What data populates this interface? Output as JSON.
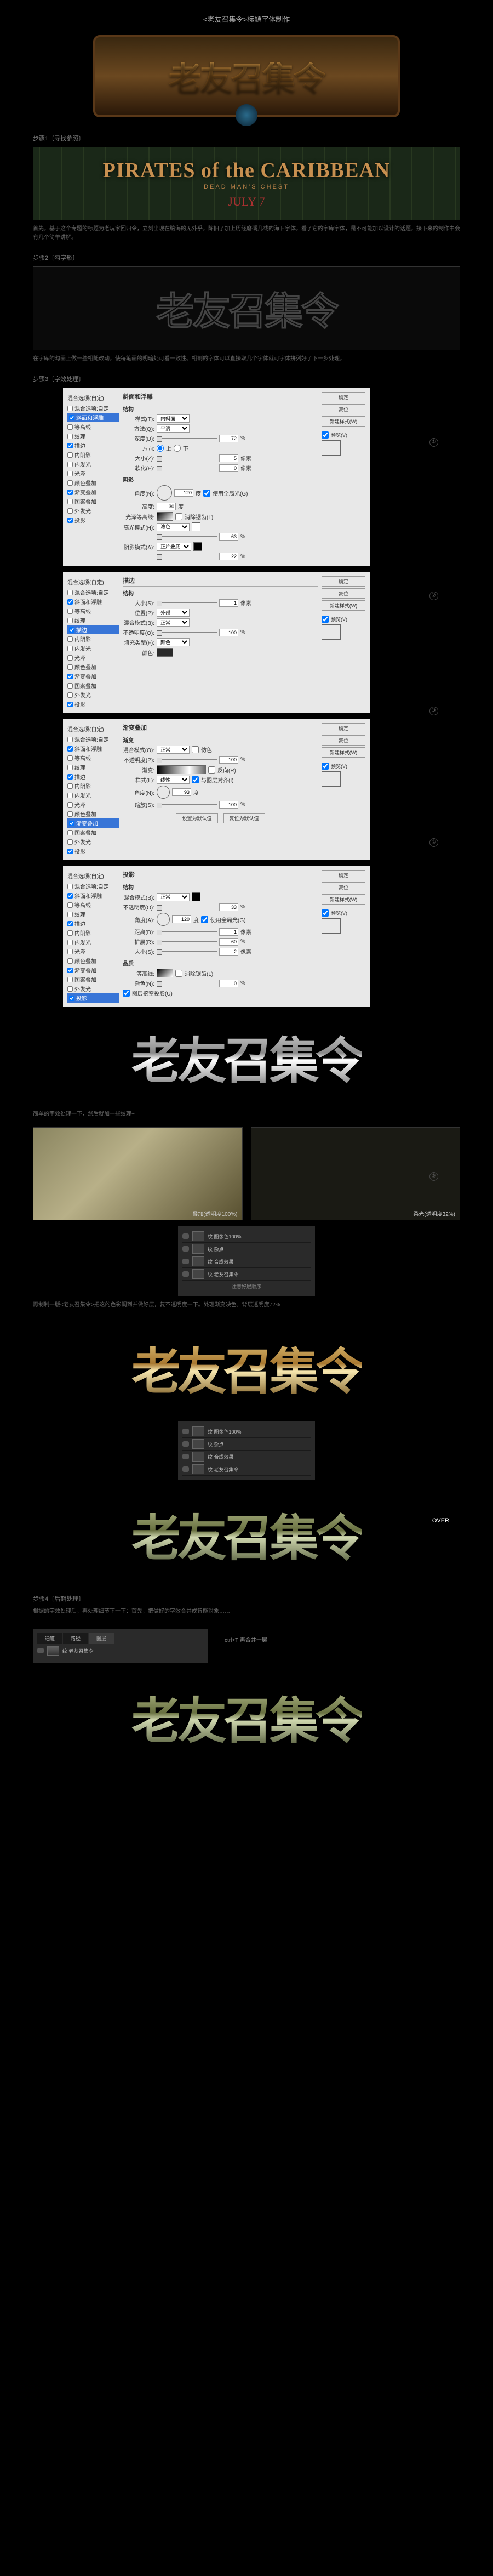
{
  "page_title": "<老友召集令>标题字体制作",
  "hero_text": "老友召集令",
  "steps": {
    "s1": {
      "label": "步骤1〔寻找参照〕",
      "caption": "首先，基于这个专题的标题为老玩家回归令，立刻出现在脑海的无外乎，陈旧了加上历经磨砺几载的海旧字体。看了它的字库字体，是不可能加以设计的话题，接下来的制作中会有几个简单讲解。"
    },
    "s2": {
      "label": "步骤2〔勾字形〕",
      "caption": "在字库的勾画上做一些相随改动，使每笔画的明暗处可看一致性。相割的字体可以直接取几个字体就可字体拼列好了下一步处理。"
    },
    "s3": {
      "label": "步骤3〔字效处理〕"
    },
    "s4": {
      "label": "步骤4〔后期处理〕",
      "caption": "根据的字效处理后，再处理细节下一下：首先，把做好的字效合并成智能对象……"
    }
  },
  "ref": {
    "title": "PIRATES of the CARIBBEAN",
    "sub": "DEAD MAN'S CHEST",
    "date": "JULY 7"
  },
  "markers": [
    "①",
    "②",
    "③",
    "④",
    "⑤"
  ],
  "ps": {
    "side_title": "混合选项(自定)",
    "checks": [
      "混合选项:自定",
      "斜面和浮雕",
      "等高线",
      "纹理",
      "描边",
      "内阴影",
      "内发光",
      "光泽",
      "颜色叠加",
      "渐变叠加",
      "图案叠加",
      "外发光",
      "投影"
    ],
    "btns": [
      "确定",
      "复位",
      "新建样式(W)"
    ],
    "preview_label": "预览(V)",
    "panel1": {
      "title": "斜面和浮雕",
      "sub": "结构",
      "style_label": "样式(T):",
      "style_val": "内斜面",
      "method_label": "方法(Q):",
      "method_val": "平滑",
      "depth_label": "深度(D):",
      "depth_val": "72",
      "depth_unit": "%",
      "dir_label": "方向:",
      "dir_up": "上",
      "dir_down": "下",
      "size_label": "大小(Z):",
      "size_val": "5",
      "size_unit": "像素",
      "soft_label": "软化(F):",
      "soft_val": "0",
      "soft_unit": "像素",
      "shade_title": "阴影",
      "angle_label": "角度(N):",
      "angle_val": "120",
      "angle_unit": "度",
      "global_label": "使用全局光(G)",
      "alt_label": "高度:",
      "alt_val": "30",
      "alt_unit": "度",
      "gloss_label": "光泽等高线:",
      "anti_label": "消除锯齿(L)",
      "hl_label": "高光模式(H):",
      "hl_val": "滤色",
      "hl_op": "63",
      "op_unit": "%",
      "sh_label": "阴影模式(A):",
      "sh_val": "正片叠底",
      "sh_op": "22"
    },
    "panel2": {
      "title": "描边",
      "sub": "结构",
      "size_label": "大小(S):",
      "size_val": "1",
      "size_unit": "像素",
      "pos_label": "位置(P):",
      "pos_val": "外部",
      "blend_label": "混合模式(B):",
      "blend_val": "正常",
      "op_label": "不透明度(O):",
      "op_val": "100",
      "op_unit": "%",
      "fill_label": "填充类型(F):",
      "fill_val": "颜色",
      "color_label": "颜色:"
    },
    "panel3": {
      "title": "渐变叠加",
      "sub": "渐变",
      "blend_label": "混合模式(O):",
      "blend_val": "正常",
      "dither": "仿色",
      "op_label": "不透明度(P):",
      "op_val": "100",
      "op_unit": "%",
      "grad_label": "渐变:",
      "rev_label": "反向(R)",
      "style_label": "样式(L):",
      "style_val": "线性",
      "align_label": "与图层对齐(I)",
      "angle_label": "角度(N):",
      "angle_val": "93",
      "angle_unit": "度",
      "scale_label": "缩放(S):",
      "scale_val": "100",
      "scale_unit": "%",
      "reset_label": "设置为默认值",
      "reset2_label": "复位为默认值"
    },
    "panel4": {
      "title": "投影",
      "sub": "结构",
      "blend_label": "混合模式(B):",
      "blend_val": "正常",
      "op_label": "不透明度(O):",
      "op_val": "33",
      "op_unit": "%",
      "angle_label": "角度(A):",
      "angle_val": "120",
      "angle_unit": "度",
      "global_label": "使用全局光(G)",
      "dist_label": "距离(D):",
      "dist_val": "1",
      "dist_unit": "像素",
      "spread_label": "扩展(R):",
      "spread_val": "60",
      "spread_unit": "%",
      "size_label": "大小(S):",
      "size_val": "2",
      "size_unit": "像素",
      "quality_title": "品质",
      "contour_label": "等高线:",
      "anti_label": "消除锯齿(L)",
      "noise_label": "杂色(N):",
      "noise_val": "0",
      "noise_unit": "%",
      "knockout_label": "图层挖空投影(U)"
    }
  },
  "mid_caption": "简单的字效处理一下，然后就加一些纹理~",
  "tex": {
    "cap1": "叠加(透明度100%)",
    "cap2": "柔光(透明度32%)"
  },
  "layers": {
    "r1": "纹 图像色100%",
    "r2": "纹 杂点",
    "r3": "纹 合成效果",
    "r4": "纹 老友召集令",
    "note": "注意好层顺序"
  },
  "recolor_caption": "再制制一版<老友召集令>把这的色彩调到并做好层，复不透明度一下。处理渐变映色。背层透明度72%",
  "over_label": "OVER",
  "ctrl": {
    "tabs": [
      "通道",
      "路径",
      "图层"
    ],
    "smart_row": "ctrl+T 再合并一层",
    "obj_label": "纹 老友召集令"
  }
}
